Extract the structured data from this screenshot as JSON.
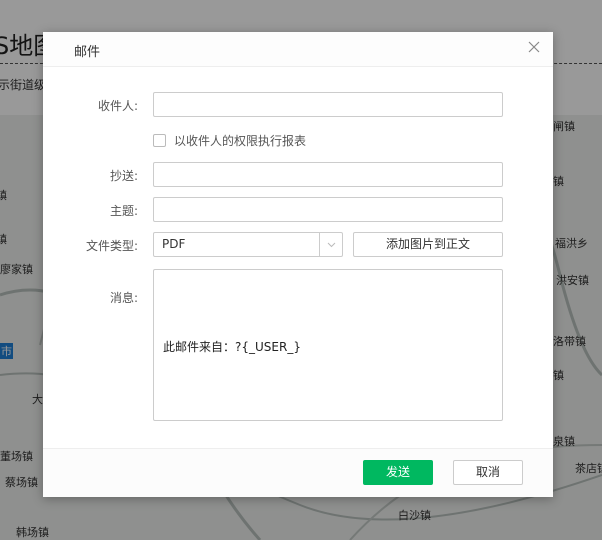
{
  "background": {
    "page_title": "S地图",
    "subtitle": "示街道级",
    "map_labels": [
      "闸镇",
      "镇",
      "福洪乡",
      "洪安镇",
      "洛带镇",
      "镇",
      "泉镇",
      "茶店镇",
      "白沙镇",
      "镇",
      "镇",
      "廖家镇",
      "市",
      "大",
      "董场镇",
      "蔡场镇",
      "韩场镇"
    ]
  },
  "dialog": {
    "title": "邮件",
    "close_icon": "close-icon",
    "fields": {
      "recipient_label": "收件人:",
      "recipient_value": "",
      "permission_checkbox_label": "以收件人的权限执行报表",
      "permission_checked": false,
      "cc_label": "抄送:",
      "cc_value": "",
      "subject_label": "主题:",
      "subject_value": "",
      "file_type_label": "文件类型:",
      "file_type_value": "PDF",
      "add_image_button": "添加图片到正文",
      "message_label": "消息:",
      "message_value": "此邮件来自：?{_USER_}"
    },
    "footer": {
      "send": "发送",
      "cancel": "取消"
    },
    "colors": {
      "primary": "#00b860"
    }
  }
}
